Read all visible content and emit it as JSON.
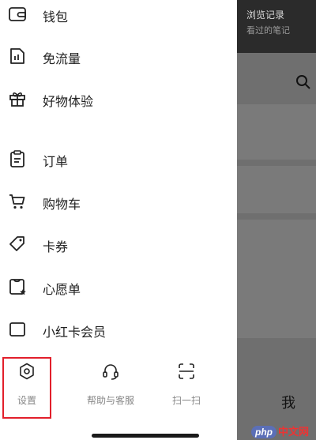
{
  "drawer": {
    "items": [
      {
        "label": "钱包",
        "icon": "wallet-icon"
      },
      {
        "label": "免流量",
        "icon": "data-free-icon"
      },
      {
        "label": "好物体验",
        "icon": "gift-icon"
      },
      {
        "label": "订单",
        "icon": "order-icon"
      },
      {
        "label": "购物车",
        "icon": "cart-icon"
      },
      {
        "label": "卡券",
        "icon": "coupon-icon"
      },
      {
        "label": "心愿单",
        "icon": "wishlist-icon"
      },
      {
        "label": "小红卡会员",
        "icon": "membership-icon"
      }
    ],
    "bottom_nav": [
      {
        "label": "设置",
        "icon": "gear-icon"
      },
      {
        "label": "帮助与客服",
        "icon": "headset-icon"
      },
      {
        "label": "扫一扫",
        "icon": "scan-icon"
      }
    ]
  },
  "background": {
    "top_line1": "浏览记录",
    "top_line2": "看过的笔记",
    "me_tab": "我"
  },
  "watermark": {
    "logo": "php",
    "text": "中文网"
  },
  "colors": {
    "highlight": "#e21f2b",
    "overlay": "#6f6f6f"
  }
}
